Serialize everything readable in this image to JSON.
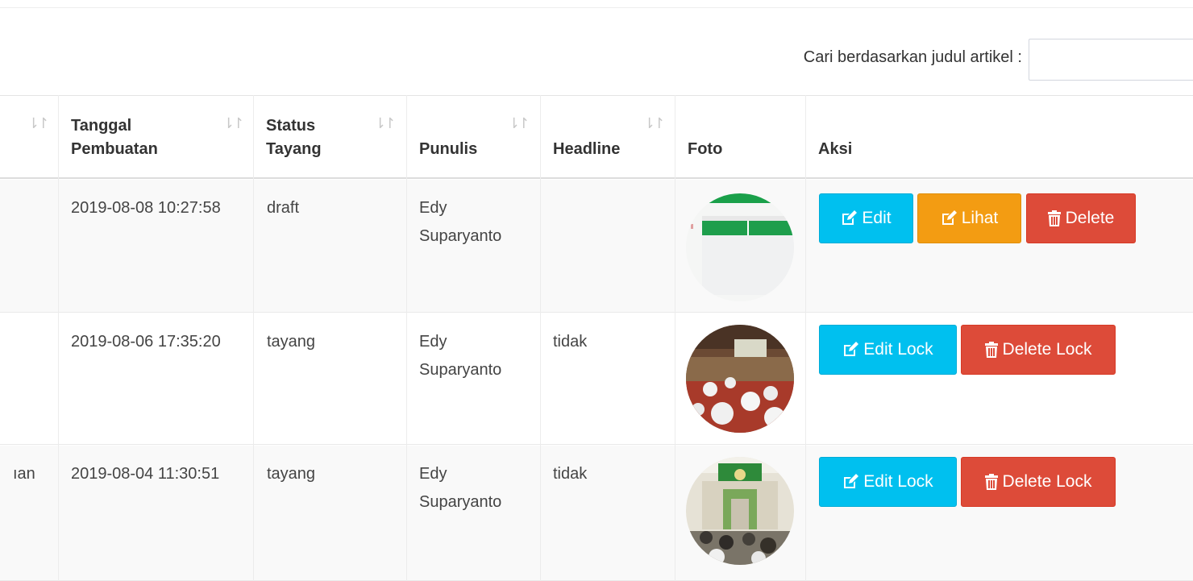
{
  "search": {
    "label": "Cari berdasarkan judul artikel :",
    "value": "",
    "placeholder": ""
  },
  "table": {
    "headers": {
      "date": "Tanggal Pembuatan",
      "status": "Status Tayang",
      "author": "Punulis",
      "headline": "Headline",
      "photo": "Foto",
      "action": "Aksi"
    },
    "sort_icon": "sort-icon",
    "rows": [
      {
        "title_fragment": "",
        "date": "2019-08-08 10:27:58",
        "status": "draft",
        "author": "Edy Suparyanto",
        "headline": "",
        "photo": "screenshot-thumbnail",
        "actions": [
          "Edit",
          "Lihat",
          "Delete"
        ]
      },
      {
        "title_fragment": "",
        "date": "2019-08-06 17:35:20",
        "status": "tayang",
        "author": "Edy Suparyanto",
        "headline": "tidak",
        "photo": "classroom-photo",
        "actions": [
          "Edit Lock",
          "Delete Lock"
        ]
      },
      {
        "title_fragment": "ıan",
        "date": "2019-08-04 11:30:51",
        "status": "tayang",
        "author": "Edy Suparyanto",
        "headline": "tidak",
        "photo": "mosque-photo",
        "actions": [
          "Edit Lock",
          "Delete Lock"
        ]
      }
    ]
  },
  "colors": {
    "info": "#00c0ef",
    "warning": "#f39c12",
    "danger": "#dd4b39"
  }
}
